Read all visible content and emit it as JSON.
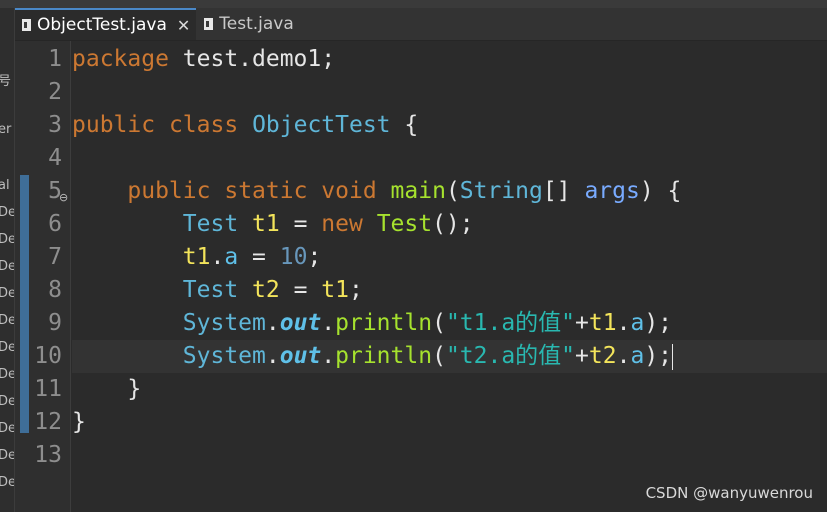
{
  "tabs": [
    {
      "label": "ObjectTest.java",
      "close": "✕",
      "active": true
    },
    {
      "label": "Test.java",
      "active": false
    }
  ],
  "left_strip": [
    "号",
    "er",
    "al",
    "De",
    "De",
    "De",
    "De",
    "De",
    "De",
    "De",
    "De",
    "De",
    "De",
    "De"
  ],
  "line_numbers": [
    "1",
    "2",
    "3",
    "4",
    "5",
    "6",
    "7",
    "8",
    "9",
    "10",
    "11",
    "12",
    "13"
  ],
  "code": {
    "l1": {
      "kw": "package",
      "rest": " test.demo1;"
    },
    "l3": {
      "kw1": "public",
      "kw2": "class",
      "name": "ObjectTest",
      "brace": " {"
    },
    "l5": {
      "kw1": "public",
      "kw2": "static",
      "kw3": "void",
      "fn": "main",
      "p1": "(",
      "type": "String",
      "p2": "[] ",
      "param": "args",
      "p3": ") {"
    },
    "l6": {
      "type": "Test",
      "var": "t1",
      "eq": " = ",
      "kw": "new",
      "fn": "Test",
      "end": "();"
    },
    "l7": {
      "var": "t1",
      "dot": ".",
      "field": "a",
      "eq": " = ",
      "num": "10",
      "end": ";"
    },
    "l8": {
      "type": "Test",
      "var": "t2",
      "eq": " = ",
      "var2": "t1",
      "end": ";"
    },
    "l9": {
      "cls": "System",
      "dot": ".",
      "out": "out",
      "dot2": ".",
      "fn": "println",
      "p1": "(",
      "str": "\"t1.a的值\"",
      "plus": "+",
      "var": "t1",
      "dot3": ".",
      "field": "a",
      "end": ");"
    },
    "l10": {
      "cls": "System",
      "dot": ".",
      "out": "out",
      "dot2": ".",
      "fn": "println",
      "p1": "(",
      "str": "\"t2.a的值\"",
      "plus": "+",
      "var": "t2",
      "dot3": ".",
      "field": "a",
      "end": ");"
    },
    "l11": {
      "brace": "}"
    },
    "l12": {
      "brace": "}"
    }
  },
  "watermark": "CSDN @wanyuwenrou",
  "colors": {
    "keyword": "#cc7832",
    "type": "#5fb6d8",
    "string": "#29b8b0",
    "method": "#a6e22e",
    "variable": "#f3e45b",
    "number": "#6897bb"
  }
}
